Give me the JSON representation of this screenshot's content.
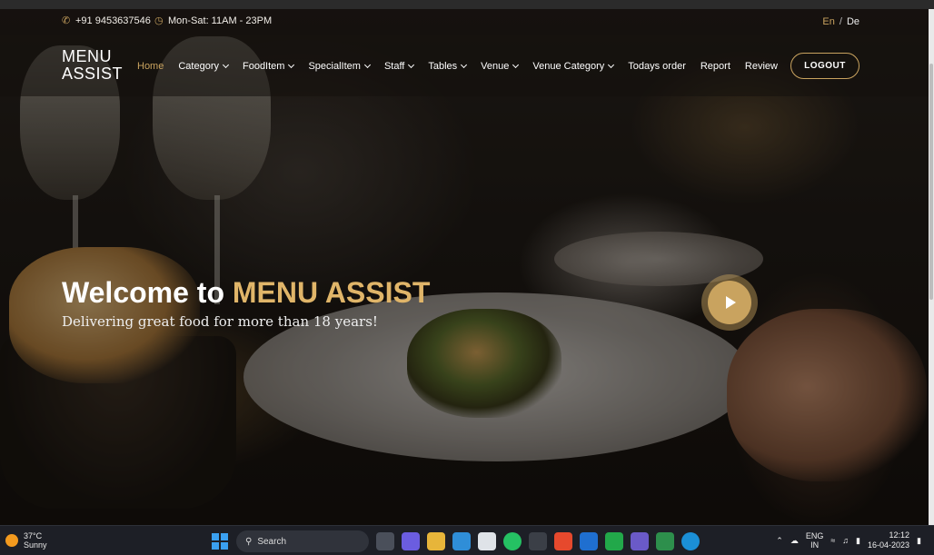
{
  "topbar": {
    "phone": "+91 9453637546",
    "hours": "Mon-Sat: 11AM - 23PM",
    "lang_en": "En",
    "lang_sep": "/",
    "lang_de": "De"
  },
  "nav": {
    "logo_line1": "MENU",
    "logo_line2": "ASSIST",
    "items": [
      {
        "label": "Home",
        "active": true,
        "dropdown": false
      },
      {
        "label": "Category",
        "dropdown": true
      },
      {
        "label": "FoodItem",
        "dropdown": true
      },
      {
        "label": "SpecialItem",
        "dropdown": true
      },
      {
        "label": "Staff",
        "dropdown": true
      },
      {
        "label": "Tables",
        "dropdown": true
      },
      {
        "label": "Venue",
        "dropdown": true
      },
      {
        "label": "Venue Category",
        "dropdown": true
      },
      {
        "label": "Todays order",
        "dropdown": false
      },
      {
        "label": "Report",
        "dropdown": false
      },
      {
        "label": "Review",
        "dropdown": false
      }
    ],
    "logout": "LOGOUT"
  },
  "hero": {
    "welcome_prefix": "Welcome to ",
    "welcome_brand": "MENU ASSIST",
    "tagline": "Delivering great food for more than 18 years!"
  },
  "taskbar": {
    "temp": "37°C",
    "condition": "Sunny",
    "search": "Search",
    "lang_line1": "ENG",
    "lang_line2": "IN",
    "time": "12:12",
    "date": "16-04-2023"
  },
  "colors": {
    "accent": "#c9a35f",
    "brand_text": "#e0b569",
    "taskbar": "#1d1f26"
  }
}
